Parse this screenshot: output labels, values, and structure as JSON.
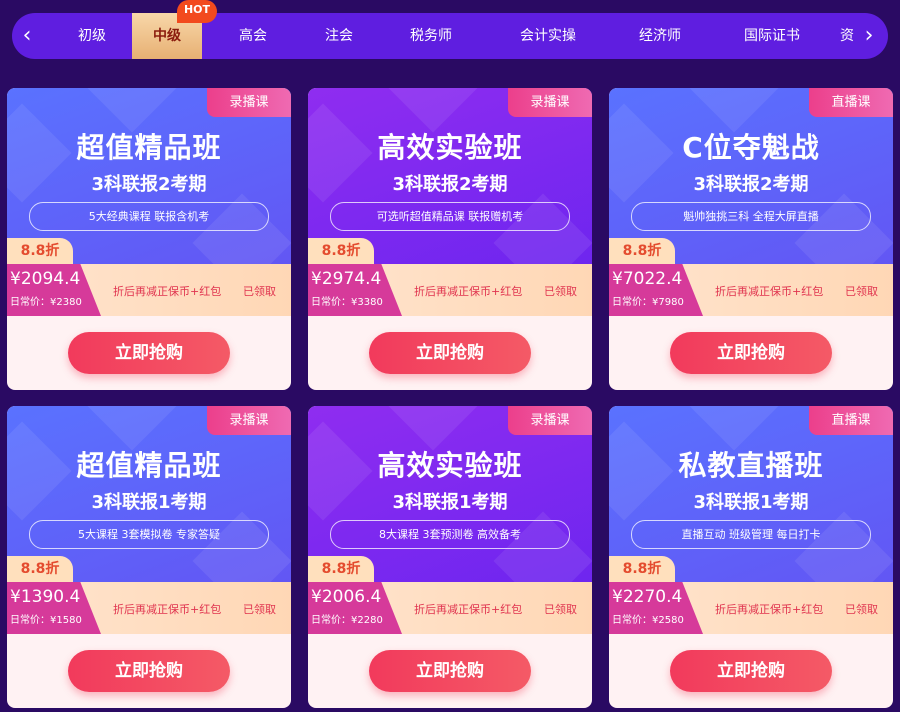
{
  "nav": {
    "tabs": [
      {
        "label": "初级",
        "active": false
      },
      {
        "label": "中级",
        "active": true
      },
      {
        "label": "高会",
        "active": false
      },
      {
        "label": "注会",
        "active": false
      },
      {
        "label": "税务师",
        "active": false
      },
      {
        "label": "会计实操",
        "active": false
      },
      {
        "label": "经济师",
        "active": false
      },
      {
        "label": "国际证书",
        "active": false
      },
      {
        "label": "资",
        "active": false
      }
    ],
    "hot_badge": "HOT",
    "prev_icon": "chevron-left-icon",
    "next_icon": "chevron-right-icon"
  },
  "cards": [
    {
      "theme": "blue",
      "type": "录播课",
      "title": "超值精品班",
      "subtitle": "3科联报2考期",
      "features": "5大经典课程 联报含机考",
      "discount": "8.8折",
      "price": "¥2094.4",
      "original": "日常价：¥2380",
      "promo": "折后再减正保币+红包",
      "claimed": "已领取",
      "button": "立即抢购"
    },
    {
      "theme": "purple",
      "type": "录播课",
      "title": "高效实验班",
      "subtitle": "3科联报2考期",
      "features": "可选听超值精品课 联报赠机考",
      "discount": "8.8折",
      "price": "¥2974.4",
      "original": "日常价：¥3380",
      "promo": "折后再减正保币+红包",
      "claimed": "已领取",
      "button": "立即抢购"
    },
    {
      "theme": "blue",
      "type": "直播课",
      "title": "C位夺魁战",
      "subtitle": "3科联报2考期",
      "features": "魁帅独挑三科 全程大屏直播",
      "discount": "8.8折",
      "price": "¥7022.4",
      "original": "日常价：¥7980",
      "promo": "折后再减正保币+红包",
      "claimed": "已领取",
      "button": "立即抢购"
    },
    {
      "theme": "blue",
      "type": "录播课",
      "title": "超值精品班",
      "subtitle": "3科联报1考期",
      "features": "5大课程 3套模拟卷 专家答疑",
      "discount": "8.8折",
      "price": "¥1390.4",
      "original": "日常价：¥1580",
      "promo": "折后再减正保币+红包",
      "claimed": "已领取",
      "button": "立即抢购"
    },
    {
      "theme": "purple",
      "type": "录播课",
      "title": "高效实验班",
      "subtitle": "3科联报1考期",
      "features": "8大课程 3套预测卷 高效备考",
      "discount": "8.8折",
      "price": "¥2006.4",
      "original": "日常价：¥2280",
      "promo": "折后再减正保币+红包",
      "claimed": "已领取",
      "button": "立即抢购"
    },
    {
      "theme": "blue",
      "type": "直播课",
      "title": "私教直播班",
      "subtitle": "3科联报1考期",
      "features": "直播互动 班级管理 每日打卡",
      "discount": "8.8折",
      "price": "¥2270.4",
      "original": "日常价：¥2580",
      "promo": "折后再减正保币+红包",
      "claimed": "已领取",
      "button": "立即抢购"
    }
  ]
}
